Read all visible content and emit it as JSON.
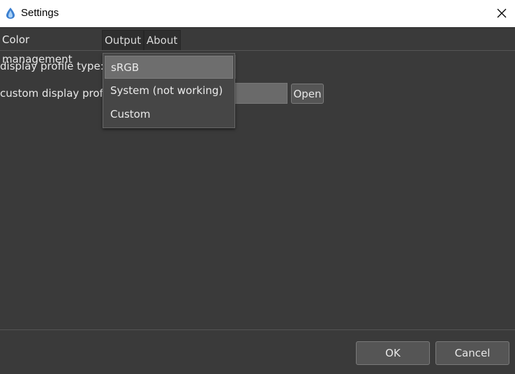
{
  "window": {
    "title": "Settings",
    "app_icon": "drop-icon",
    "close_icon": "close-icon"
  },
  "tabs": [
    {
      "label": "Color management",
      "active": true
    },
    {
      "label": "Output",
      "active": false
    },
    {
      "label": "About",
      "active": false
    }
  ],
  "form": {
    "display_profile_type_label": "display profile type:",
    "custom_display_profile_label": "custom display profile",
    "display_profile_type_value": "sRGB",
    "custom_profile_path": "",
    "open_button": "Open"
  },
  "dropdown": {
    "options": [
      "sRGB",
      "System (not working)",
      "Custom"
    ],
    "selected": "sRGB"
  },
  "footer": {
    "ok": "OK",
    "cancel": "Cancel"
  },
  "colors": {
    "background": "#3a3a3a",
    "titlebar": "#ffffff",
    "text": "#e8e8e8"
  }
}
